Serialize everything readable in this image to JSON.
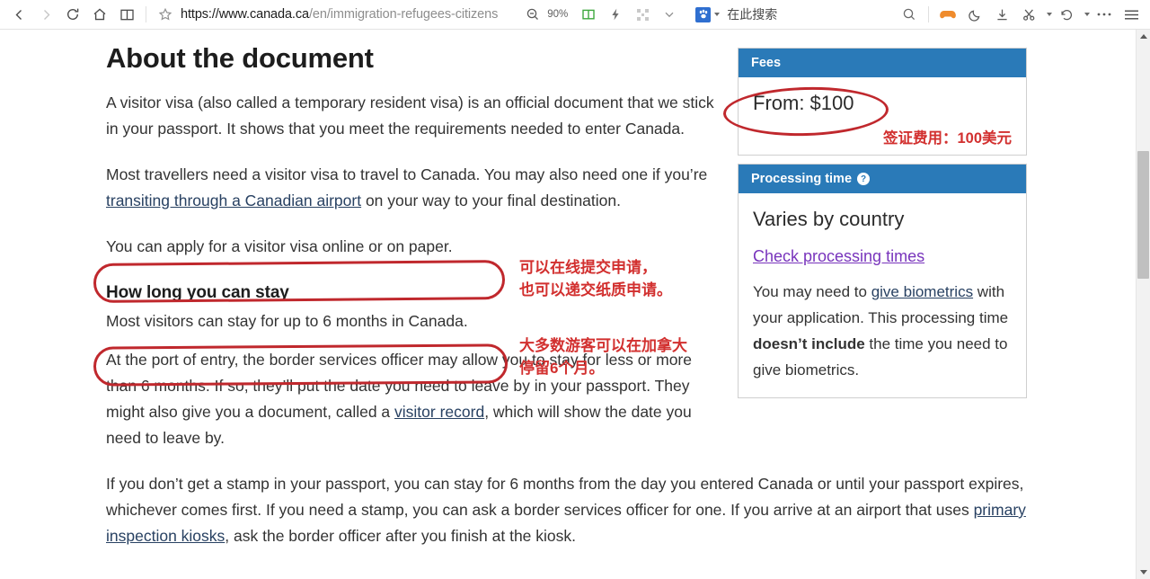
{
  "browser": {
    "nav": {
      "back": "back-arrow",
      "forward": "forward-arrow",
      "reload": "reload",
      "home": "home",
      "reading_list": "book"
    },
    "address": {
      "bookmark_icon": "star-outline-icon",
      "domain": "https://www.canada.ca",
      "path": "/en/immigration-refugees-citizens"
    },
    "zoom": {
      "icon": "zoom-out-icon",
      "level": "90%"
    },
    "toolbar_icons": [
      "reader-mode-icon",
      "lightning-icon",
      "qr-grid-icon",
      "chevron-down-icon"
    ],
    "search_engine": {
      "badge": "paw-icon",
      "placeholder": "在此搜索"
    },
    "right_icons": [
      "search-icon",
      "gamepad-icon",
      "dark-mode-moon-icon",
      "download-icon",
      "scissors-clip-icon",
      "history-undo-icon",
      "more-ellipsis-icon",
      "hamburger-menu-icon"
    ]
  },
  "page": {
    "title": "About the document",
    "paragraphs": {
      "p1": "A visitor visa (also called a temporary resident visa) is an official document that we stick in your passport. It shows that you meet the requirements needed to enter Canada.",
      "p2_before": "Most travellers need a visitor visa to travel to Canada. You may also need one if you’re ",
      "p2_link": "transiting through a Canadian airport",
      "p2_after": " on your way to your final destination.",
      "p3_highlight": "You can apply for a visitor visa online or on paper.",
      "p5_before": "At the port of entry, the border services officer may allow you to stay for less or more than 6 months. If so, they’ll put the date you need to leave by in your passport. They might also give you a document, called a ",
      "p5_link": "visitor record",
      "p5_after": ", which will show the date you need to leave by.",
      "p6_before": "If you don’t get a stamp in your passport, you can stay for 6 months from the day you entered Canada or until your passport expires, whichever comes first. If you need a stamp, you can ask a border services officer for one. If you arrive at an airport that uses ",
      "p6_link": "primary inspection kiosks",
      "p6_after": ", ask the border officer after you finish at the kiosk."
    },
    "section_heading": "How long you can stay",
    "p4_highlight": "Most visitors can stay for up to 6 months in Canada."
  },
  "annotations": {
    "color": "#d2302f",
    "apply_note_line1": "可以在线提交申请，",
    "apply_note_line2": "也可以递交纸质申请。",
    "stay_note_line1": "大多数游客可以在加拿大",
    "stay_note_line2": "停留6个月。",
    "fee_note": "签证费用：100美元"
  },
  "sidebar": {
    "accent_color": "#2a7ab8",
    "fees": {
      "header": "Fees",
      "amount": "From: $100"
    },
    "processing": {
      "header": "Processing time",
      "help_glyph": "?",
      "value": "Varies by country",
      "link": "Check processing times",
      "note_before": "You may need to ",
      "note_link": "give biometrics",
      "note_mid": " with your application. This processing time ",
      "note_bold": "doesn’t include",
      "note_after": " the time you need to give biometrics."
    }
  },
  "scrollbar": {
    "up_arrow": "scroll-up-arrow",
    "down_arrow": "scroll-down-arrow"
  }
}
